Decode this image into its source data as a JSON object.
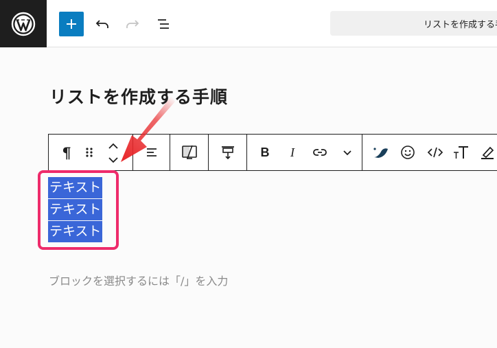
{
  "topbar": {
    "logo": "wordpress-icon",
    "add_button": "plus-icon",
    "undo": "undo-icon",
    "redo": "redo-icon",
    "document_overview": "list-view-icon",
    "document_title": "リストを作成する手順"
  },
  "editor": {
    "heading": "リストを作成する手順",
    "list_items": [
      "テキスト",
      "テキスト",
      "テキスト"
    ],
    "placeholder": "ブロックを選択するには「/」を入力"
  },
  "block_toolbar": {
    "items": [
      "paragraph-icon",
      "drag-handle-icon",
      "move-up-icon",
      "move-down-icon",
      "align-icon",
      "image-replace-icon",
      "vertical-align-icon",
      "bold-icon",
      "italic-icon",
      "link-icon",
      "more-options-icon",
      "plugin-icon",
      "emoji-icon",
      "code-icon",
      "font-size-icon",
      "highlight-icon"
    ],
    "bold_label": "B",
    "italic_label": "I",
    "paragraph_label": "¶"
  },
  "colors": {
    "accent": "#0a7dc0",
    "selection": "#3a66d8",
    "annotation": "#ee2b6b",
    "arrow": "#e8282b"
  }
}
